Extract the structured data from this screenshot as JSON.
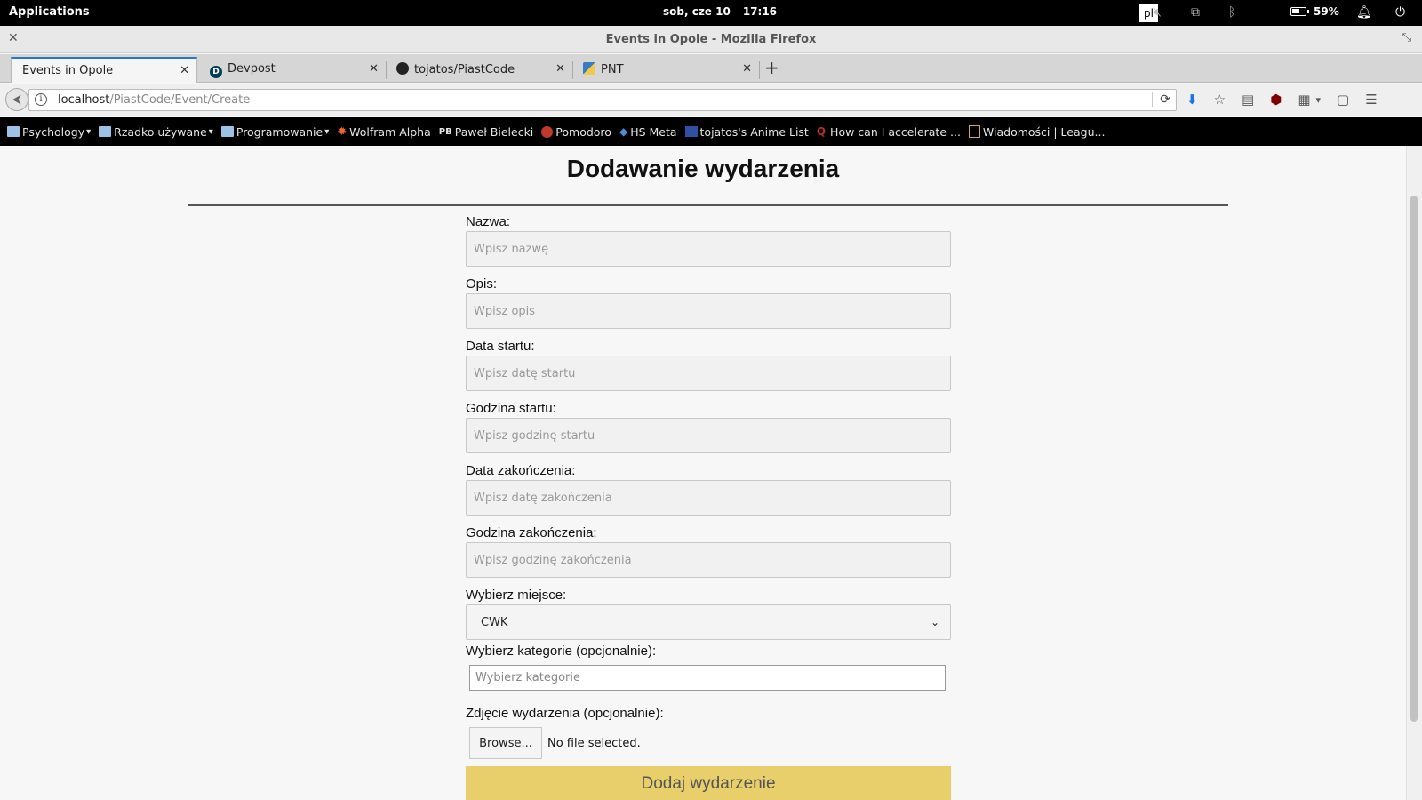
{
  "panel": {
    "applications": "Applications",
    "date": "sob, cze 10",
    "time": "17:16",
    "language": "pl",
    "battery": "59%"
  },
  "window": {
    "title": "Events in Opole - Mozilla Firefox"
  },
  "tabs": [
    {
      "label": "Events in Opole",
      "active": true
    },
    {
      "label": "Devpost",
      "active": false
    },
    {
      "label": "tojatos/PiastCode",
      "active": false
    },
    {
      "label": "PNT",
      "active": false
    }
  ],
  "navbar": {
    "url_host": "localhost",
    "url_path": "/PiastCode/Event/Create"
  },
  "bookmarks": [
    {
      "label": "Psychology",
      "type": "folder"
    },
    {
      "label": "Rzadko używane",
      "type": "folder"
    },
    {
      "label": "Programowanie",
      "type": "folder"
    },
    {
      "label": "Wolfram Alpha",
      "type": "link"
    },
    {
      "label": "Paweł Bielecki",
      "type": "link"
    },
    {
      "label": "Pomodoro",
      "type": "link"
    },
    {
      "label": "HS Meta",
      "type": "link"
    },
    {
      "label": "tojatos's Anime List",
      "type": "link"
    },
    {
      "label": "How can I accelerate ...",
      "type": "link"
    },
    {
      "label": "Wiadomości | Leagu...",
      "type": "link"
    }
  ],
  "page": {
    "title": "Dodawanie wydarzenia",
    "fields": [
      {
        "label": "Nazwa:",
        "placeholder": "Wpisz nazwę"
      },
      {
        "label": "Opis:",
        "placeholder": "Wpisz opis"
      },
      {
        "label": "Data startu:",
        "placeholder": "Wpisz datę startu"
      },
      {
        "label": "Godzina startu:",
        "placeholder": "Wpisz godzinę startu"
      },
      {
        "label": "Data zakończenia:",
        "placeholder": "Wpisz datę zakończenia"
      },
      {
        "label": "Godzina zakończenia:",
        "placeholder": "Wpisz godzinę zakończenia"
      }
    ],
    "place": {
      "label": "Wybierz miejsce:",
      "value": "CWK"
    },
    "category": {
      "label": "Wybierz kategorie (opcjonalnie):",
      "placeholder": "Wybierz kategorie"
    },
    "photo": {
      "label": "Zdjęcie wydarzenia (opcjonalnie):",
      "button": "Browse...",
      "status": "No file selected."
    },
    "submit": "Dodaj wydarzenie"
  },
  "colors": {
    "submit": "#e9cf6b",
    "tab_accent": "#2a76c6"
  }
}
